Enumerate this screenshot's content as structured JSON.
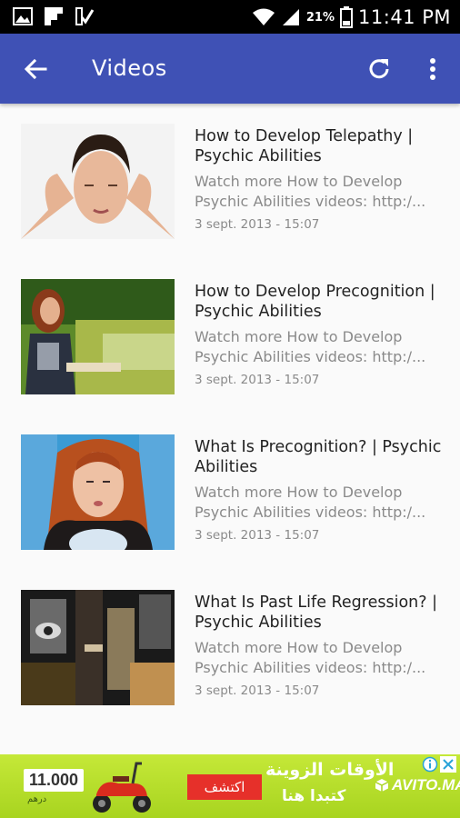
{
  "status_bar": {
    "battery_percent": "21%",
    "time": "11:41 PM"
  },
  "app_bar": {
    "title": "Videos"
  },
  "videos": [
    {
      "title": "How to Develop Telepathy | Psychic Abilities",
      "desc_line1": "Watch more How to Develop",
      "desc_line2": "Psychic Abilities videos: http:/...",
      "date": "3 sept. 2013 - 15:07"
    },
    {
      "title": "How to Develop Precognition | Psychic Abilities",
      "desc_line1": "Watch more How to Develop",
      "desc_line2": "Psychic Abilities videos: http:/...",
      "date": "3 sept. 2013 - 15:07"
    },
    {
      "title": "What Is Precognition? | Psychic Abilities",
      "desc_line1": "Watch more How to Develop",
      "desc_line2": "Psychic Abilities videos: http:/...",
      "date": "3 sept. 2013 - 15:07"
    },
    {
      "title": "What Is Past Life Regression? | Psychic Abilities",
      "desc_line1": "Watch more How to Develop",
      "desc_line2": "Psychic Abilities videos: http:/...",
      "date": "3 sept. 2013 - 15:07"
    }
  ],
  "ad": {
    "price": "11.000",
    "currency": "درهم",
    "cta": "اكتشف",
    "headline": "الأوقات الزوينة",
    "subline": "كتبدا هنا",
    "brand": "AVITO.MA"
  },
  "colors": {
    "app_bar": "#3f51b5",
    "background": "#fafafa",
    "ad_green": "#b5dd2a"
  }
}
